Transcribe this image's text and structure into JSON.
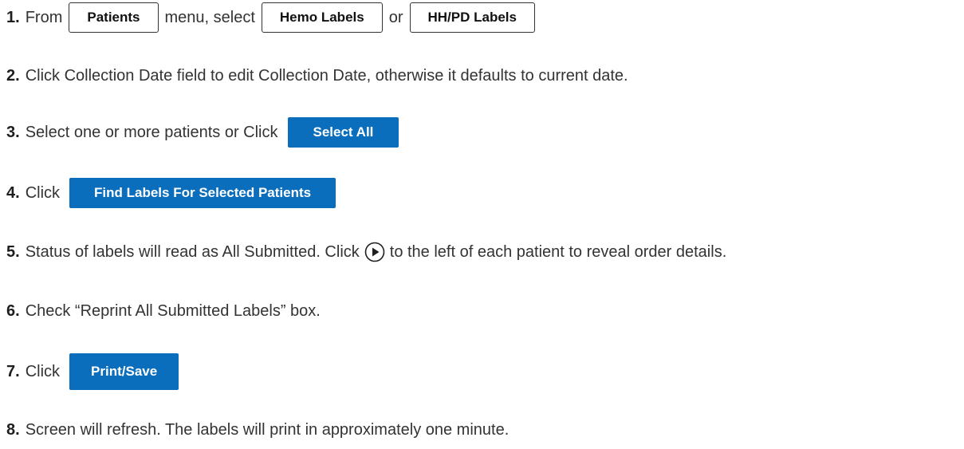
{
  "steps": [
    {
      "num": "1.",
      "parts": {
        "a": "From",
        "b": "menu, select",
        "c": "or"
      },
      "buttons": {
        "patients": "Patients",
        "hemo": "Hemo Labels",
        "hhpd": "HH/PD Labels"
      }
    },
    {
      "num": "2.",
      "text": "Click Collection Date field to edit Collection Date, otherwise it defaults to current date."
    },
    {
      "num": "3.",
      "text": "Select one or more patients or Click",
      "button": "Select All"
    },
    {
      "num": "4.",
      "text": "Click",
      "button": "Find Labels For Selected Patients"
    },
    {
      "num": "5.",
      "text_before": "Status of labels will read as All Submitted.  Click",
      "text_after": "to the left of each patient to reveal order details.",
      "icon": "play-circle-icon"
    },
    {
      "num": "6.",
      "text": "Check “Reprint All Submitted Labels” box."
    },
    {
      "num": "7.",
      "text": "Click",
      "button": "Print/Save"
    },
    {
      "num": "8.",
      "text": "Screen will refresh.  The labels will print in approximately one minute."
    }
  ],
  "colors": {
    "button_blue": "#0a6ebd",
    "text": "#333333"
  }
}
